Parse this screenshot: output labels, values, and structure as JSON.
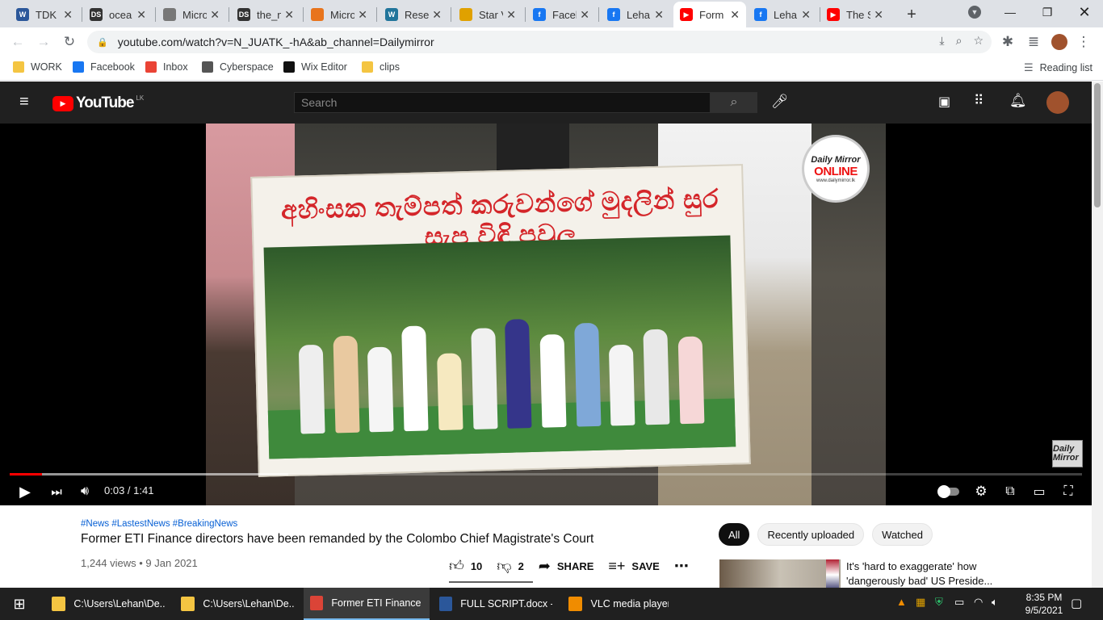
{
  "browser": {
    "tabs": [
      {
        "title": "TDK I",
        "icon": "word-icon",
        "color": "#2b579a",
        "glyph": "W"
      },
      {
        "title": "ocea",
        "icon": "ds-icon",
        "color": "#333333",
        "glyph": "DS"
      },
      {
        "title": "Micro",
        "icon": "web-icon",
        "color": "#777777",
        "glyph": ""
      },
      {
        "title": "the_n",
        "icon": "ds-icon",
        "color": "#333333",
        "glyph": "DS"
      },
      {
        "title": "Micro",
        "icon": "app-icon",
        "color": "#e8741c",
        "glyph": ""
      },
      {
        "title": "Rese",
        "icon": "wordpress-icon",
        "color": "#21759b",
        "glyph": "W"
      },
      {
        "title": "Star V",
        "icon": "folder-icon",
        "color": "#e0a100",
        "glyph": ""
      },
      {
        "title": "Facel",
        "icon": "facebook-icon",
        "color": "#1877f2",
        "glyph": "f"
      },
      {
        "title": "Leha",
        "icon": "facebook-icon",
        "color": "#1877f2",
        "glyph": "f"
      },
      {
        "title": "Form",
        "icon": "youtube-icon",
        "color": "#ff0000",
        "glyph": "▶"
      },
      {
        "title": "Leha",
        "icon": "facebook-icon",
        "color": "#1877f2",
        "glyph": "f"
      },
      {
        "title": "The S",
        "icon": "youtube-icon",
        "color": "#ff0000",
        "glyph": "▶"
      }
    ],
    "new_tab": "+",
    "url": "youtube.com/watch?v=N_JUATK_-hA&ab_channel=Dailymirror",
    "bookmarks": [
      {
        "label": "WORK",
        "icon": "folder-icon",
        "color": "#f4c542"
      },
      {
        "label": "Facebook",
        "icon": "facebook-icon",
        "color": "#1877f2"
      },
      {
        "label": "Inbox",
        "icon": "gmail-icon",
        "color": "#ea4335"
      },
      {
        "label": "Cyberspace",
        "icon": "cyberspace-icon",
        "color": "#555555"
      },
      {
        "label": "Wix Editor",
        "icon": "wix-icon",
        "color": "#111111"
      },
      {
        "label": "clips",
        "icon": "folder-icon",
        "color": "#f4c542"
      }
    ],
    "reading_list": "Reading list"
  },
  "youtube": {
    "logo_text": "YouTube",
    "country": "LK",
    "search_placeholder": "Search",
    "video": {
      "banner_text": "අහිංසක තැම්පත් කරුවන්ගේ මුදලින් සුර සැප විඳි පවුල",
      "logo_line1": "Daily Mirror",
      "logo_line2": "ONLINE",
      "logo_line3": "www.dailymirror.lk",
      "watermark": "Daily Mirror",
      "time": "0:03 / 1:41",
      "progress": 0.03,
      "buffered": 0.26
    },
    "hashtags": "#News #LastestNews #BreakingNews",
    "title": "Former ETI Finance directors have been remanded by the Colombo Chief Magistrate's Court",
    "meta": "1,244 views • 9 Jan 2021",
    "likes": "10",
    "dislikes": "2",
    "share": "SHARE",
    "save": "SAVE",
    "chips": [
      "All",
      "Recently uploaded",
      "Watched"
    ],
    "rec_title": "It's 'hard to exaggerate' how 'dangerously bad' US Preside..."
  },
  "taskbar": {
    "items": [
      {
        "label": "C:\\Users\\Lehan\\De...",
        "icon": "folder-icon",
        "color": "#f4c542"
      },
      {
        "label": "C:\\Users\\Lehan\\De...",
        "icon": "folder-icon",
        "color": "#f4c542"
      },
      {
        "label": "Former ETI Finance ...",
        "icon": "chrome-icon",
        "color": "#db4437"
      },
      {
        "label": "FULL SCRIPT.docx -...",
        "icon": "word-icon",
        "color": "#2b579a"
      },
      {
        "label": "VLC media player",
        "icon": "vlc-icon",
        "color": "#f08c00"
      }
    ],
    "time": "8:35 PM",
    "date": "9/5/2021"
  }
}
